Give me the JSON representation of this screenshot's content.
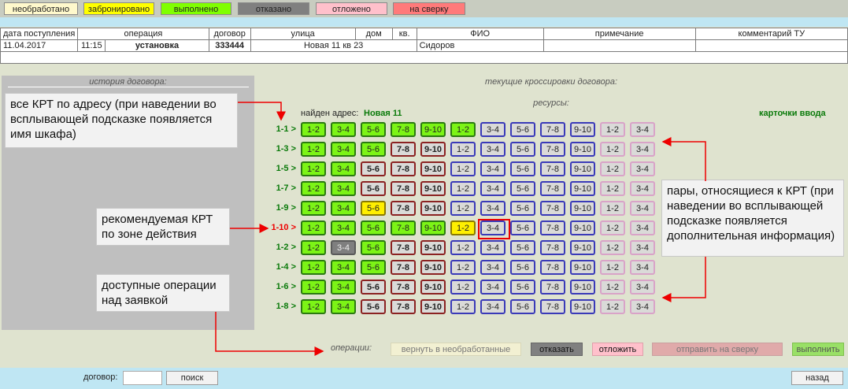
{
  "status_legend": [
    {
      "label": "необработано",
      "color": "#fff9cc"
    },
    {
      "label": "забронировано",
      "color": "#ffff00"
    },
    {
      "label": "выполнено",
      "color": "#80ff00"
    },
    {
      "label": "отказано",
      "color": "#808080"
    },
    {
      "label": "отложено",
      "color": "#ffc0cb"
    },
    {
      "label": "на сверку",
      "color": "#ff7a7a"
    }
  ],
  "info_table": {
    "headers": [
      "дата поступления",
      "операция",
      "договор",
      "улица",
      "дом",
      "кв.",
      "ФИО",
      "примечание",
      "комментарий ТУ"
    ],
    "row": {
      "date": "11.04.2017",
      "time": "11:15",
      "operation": "установка",
      "contract": "333444",
      "address": "Новая 11 кв 23",
      "fio": "Сидоров"
    }
  },
  "history": {
    "title": "история договора:"
  },
  "main": {
    "crossover_title": "текущие кроссировки договора:",
    "resources_title": "ресурсы:",
    "address_found_label": "найден адрес:",
    "address_found_value": "Новая 11",
    "input_cards_label": "карточки ввода"
  },
  "krt_rows": [
    {
      "label": "1-1 >",
      "cells": [
        [
          "1-2",
          "g"
        ],
        [
          "3-4",
          "g"
        ],
        [
          "5-6",
          "g"
        ],
        [
          "7-8",
          "g"
        ],
        [
          "9-10",
          "g"
        ],
        [
          "1-2",
          "g"
        ],
        [
          "3-4",
          "b"
        ],
        [
          "5-6",
          "b"
        ],
        [
          "7-8",
          "b"
        ],
        [
          "9-10",
          "b"
        ],
        [
          "1-2",
          "p"
        ],
        [
          "3-4",
          "p"
        ]
      ]
    },
    {
      "label": "1-3 >",
      "cells": [
        [
          "1-2",
          "g"
        ],
        [
          "3-4",
          "g"
        ],
        [
          "5-6",
          "g"
        ],
        [
          "7-8",
          "r"
        ],
        [
          "9-10",
          "r"
        ],
        [
          "1-2",
          "b"
        ],
        [
          "3-4",
          "b"
        ],
        [
          "5-6",
          "b"
        ],
        [
          "7-8",
          "b"
        ],
        [
          "9-10",
          "b"
        ],
        [
          "1-2",
          "p"
        ],
        [
          "3-4",
          "p"
        ]
      ]
    },
    {
      "label": "1-5 >",
      "cells": [
        [
          "1-2",
          "g"
        ],
        [
          "3-4",
          "g"
        ],
        [
          "5-6",
          "r"
        ],
        [
          "7-8",
          "r"
        ],
        [
          "9-10",
          "r"
        ],
        [
          "1-2",
          "b"
        ],
        [
          "3-4",
          "b"
        ],
        [
          "5-6",
          "b"
        ],
        [
          "7-8",
          "b"
        ],
        [
          "9-10",
          "b"
        ],
        [
          "1-2",
          "p"
        ],
        [
          "3-4",
          "p"
        ]
      ]
    },
    {
      "label": "1-7 >",
      "cells": [
        [
          "1-2",
          "g"
        ],
        [
          "3-4",
          "g"
        ],
        [
          "5-6",
          "r"
        ],
        [
          "7-8",
          "r"
        ],
        [
          "9-10",
          "r"
        ],
        [
          "1-2",
          "b"
        ],
        [
          "3-4",
          "b"
        ],
        [
          "5-6",
          "b"
        ],
        [
          "7-8",
          "b"
        ],
        [
          "9-10",
          "b"
        ],
        [
          "1-2",
          "p"
        ],
        [
          "3-4",
          "p"
        ]
      ]
    },
    {
      "label": "1-9 >",
      "cells": [
        [
          "1-2",
          "g"
        ],
        [
          "3-4",
          "g"
        ],
        [
          "5-6",
          "y"
        ],
        [
          "7-8",
          "r"
        ],
        [
          "9-10",
          "r"
        ],
        [
          "1-2",
          "b"
        ],
        [
          "3-4",
          "b"
        ],
        [
          "5-6",
          "b"
        ],
        [
          "7-8",
          "b"
        ],
        [
          "9-10",
          "b"
        ],
        [
          "1-2",
          "p"
        ],
        [
          "3-4",
          "p"
        ]
      ]
    },
    {
      "label": "1-10 >",
      "cells": [
        [
          "1-2",
          "g"
        ],
        [
          "3-4",
          "g"
        ],
        [
          "5-6",
          "g"
        ],
        [
          "7-8",
          "g"
        ],
        [
          "9-10",
          "g"
        ],
        [
          "1-2",
          "y"
        ],
        [
          "3-4",
          "b"
        ],
        [
          "5-6",
          "b"
        ],
        [
          "7-8",
          "b"
        ],
        [
          "9-10",
          "b"
        ],
        [
          "1-2",
          "p"
        ],
        [
          "3-4",
          "p"
        ]
      ],
      "recommended": true
    },
    {
      "label": "1-2 >",
      "cells": [
        [
          "1-2",
          "g"
        ],
        [
          "3-4",
          "d"
        ],
        [
          "5-6",
          "g"
        ],
        [
          "7-8",
          "r"
        ],
        [
          "9-10",
          "r"
        ],
        [
          "1-2",
          "b"
        ],
        [
          "3-4",
          "b"
        ],
        [
          "5-6",
          "b"
        ],
        [
          "7-8",
          "b"
        ],
        [
          "9-10",
          "b"
        ],
        [
          "1-2",
          "p"
        ],
        [
          "3-4",
          "p"
        ]
      ]
    },
    {
      "label": "1-4 >",
      "cells": [
        [
          "1-2",
          "g"
        ],
        [
          "3-4",
          "g"
        ],
        [
          "5-6",
          "g"
        ],
        [
          "7-8",
          "r"
        ],
        [
          "9-10",
          "r"
        ],
        [
          "1-2",
          "b"
        ],
        [
          "3-4",
          "b"
        ],
        [
          "5-6",
          "b"
        ],
        [
          "7-8",
          "b"
        ],
        [
          "9-10",
          "b"
        ],
        [
          "1-2",
          "p"
        ],
        [
          "3-4",
          "p"
        ]
      ]
    },
    {
      "label": "1-6 >",
      "cells": [
        [
          "1-2",
          "g"
        ],
        [
          "3-4",
          "g"
        ],
        [
          "5-6",
          "r"
        ],
        [
          "7-8",
          "r"
        ],
        [
          "9-10",
          "r"
        ],
        [
          "1-2",
          "b"
        ],
        [
          "3-4",
          "b"
        ],
        [
          "5-6",
          "b"
        ],
        [
          "7-8",
          "b"
        ],
        [
          "9-10",
          "b"
        ],
        [
          "1-2",
          "p"
        ],
        [
          "3-4",
          "p"
        ]
      ]
    },
    {
      "label": "1-8 >",
      "cells": [
        [
          "1-2",
          "g"
        ],
        [
          "3-4",
          "g"
        ],
        [
          "5-6",
          "r"
        ],
        [
          "7-8",
          "r"
        ],
        [
          "9-10",
          "r"
        ],
        [
          "1-2",
          "b"
        ],
        [
          "3-4",
          "b"
        ],
        [
          "5-6",
          "b"
        ],
        [
          "7-8",
          "b"
        ],
        [
          "9-10",
          "b"
        ],
        [
          "1-2",
          "p"
        ],
        [
          "3-4",
          "p"
        ]
      ]
    }
  ],
  "callouts": {
    "all_krt": "все КРТ по адресу (при наведении во всплывающей подсказке появляется имя шкафа)",
    "recommended": "рекомендуемая КРТ по зоне действия",
    "operations_note": "доступные операции над заявкой",
    "pairs": "пары, относящиеся к КРТ (при наведении во всплывающей подсказке появляется дополнительная информация)"
  },
  "operations": {
    "label": "операции:",
    "return": "вернуть в необработанные",
    "refuse": "отказать",
    "postpone": "отложить",
    "send_check": "отправить на сверку",
    "done": "выполнить"
  },
  "footer": {
    "contract_label": "договор:",
    "contract_value": "",
    "search": "поиск",
    "back": "назад"
  }
}
